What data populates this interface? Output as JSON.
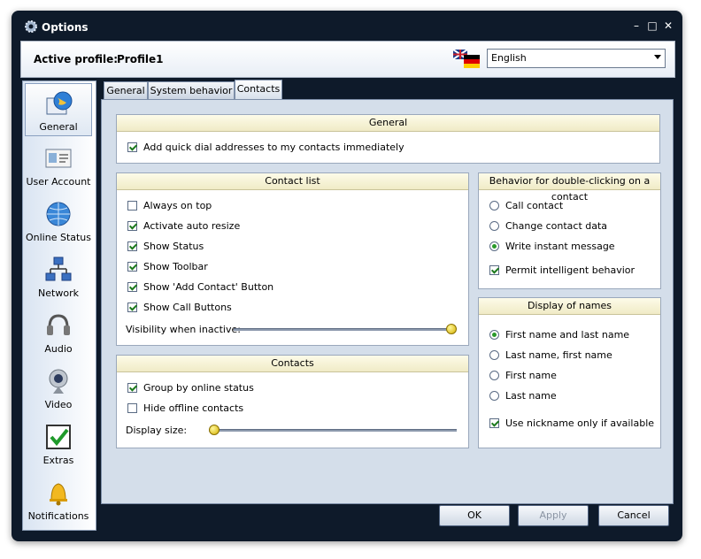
{
  "window": {
    "title": "Options"
  },
  "profile": {
    "label": "Active profile:",
    "name": "Profile1",
    "language": "English"
  },
  "sidebar": {
    "items": [
      {
        "label": "General",
        "icon": "globe-window-icon",
        "active": true
      },
      {
        "label": "User Account",
        "icon": "id-card-icon",
        "active": false
      },
      {
        "label": "Online Status",
        "icon": "globe-icon",
        "active": false
      },
      {
        "label": "Network",
        "icon": "network-icon",
        "active": false
      },
      {
        "label": "Audio",
        "icon": "headset-icon",
        "active": false
      },
      {
        "label": "Video",
        "icon": "webcam-icon",
        "active": false
      },
      {
        "label": "Extras",
        "icon": "checklist-icon",
        "active": false
      },
      {
        "label": "Notifications",
        "icon": "bell-icon",
        "active": false
      }
    ]
  },
  "tabs": [
    {
      "label": "General",
      "active": false
    },
    {
      "label": "System behavior",
      "active": false
    },
    {
      "label": "Contacts",
      "active": true
    }
  ],
  "general_panel": {
    "title": "General",
    "options": [
      {
        "label": "Add quick dial addresses to my contacts immediately",
        "checked": true
      }
    ]
  },
  "contact_list_panel": {
    "title": "Contact list",
    "options": [
      {
        "label": "Always on top",
        "checked": false
      },
      {
        "label": "Activate auto resize",
        "checked": true
      },
      {
        "label": "Show Status",
        "checked": true
      },
      {
        "label": "Show Toolbar",
        "checked": true
      },
      {
        "label": "Show 'Add Contact' Button",
        "checked": true
      },
      {
        "label": "Show Call Buttons",
        "checked": true
      }
    ],
    "visibility_label": "Visibility when inactive:",
    "visibility_value": 1.0
  },
  "contacts_panel": {
    "title": "Contacts",
    "options": [
      {
        "label": "Group by online status",
        "checked": true
      },
      {
        "label": "Hide offline contacts",
        "checked": false
      }
    ],
    "display_size_label": "Display size:",
    "display_size_value": 0.0
  },
  "double_click_panel": {
    "title": "Behavior for double-clicking on a contact",
    "options": [
      {
        "label": "Call contact",
        "checked": false
      },
      {
        "label": "Change contact data",
        "checked": false
      },
      {
        "label": "Write instant message",
        "checked": true
      }
    ],
    "extra": {
      "label": "Permit intelligent behavior",
      "checked": true
    }
  },
  "names_panel": {
    "title": "Display of names",
    "options": [
      {
        "label": "First name and last name",
        "checked": true
      },
      {
        "label": "Last name, first name",
        "checked": false
      },
      {
        "label": "First name",
        "checked": false
      },
      {
        "label": "Last name",
        "checked": false
      }
    ],
    "extra": {
      "label": "Use nickname only if available",
      "checked": true
    }
  },
  "buttons": {
    "ok": "OK",
    "apply": "Apply",
    "cancel": "Cancel"
  }
}
